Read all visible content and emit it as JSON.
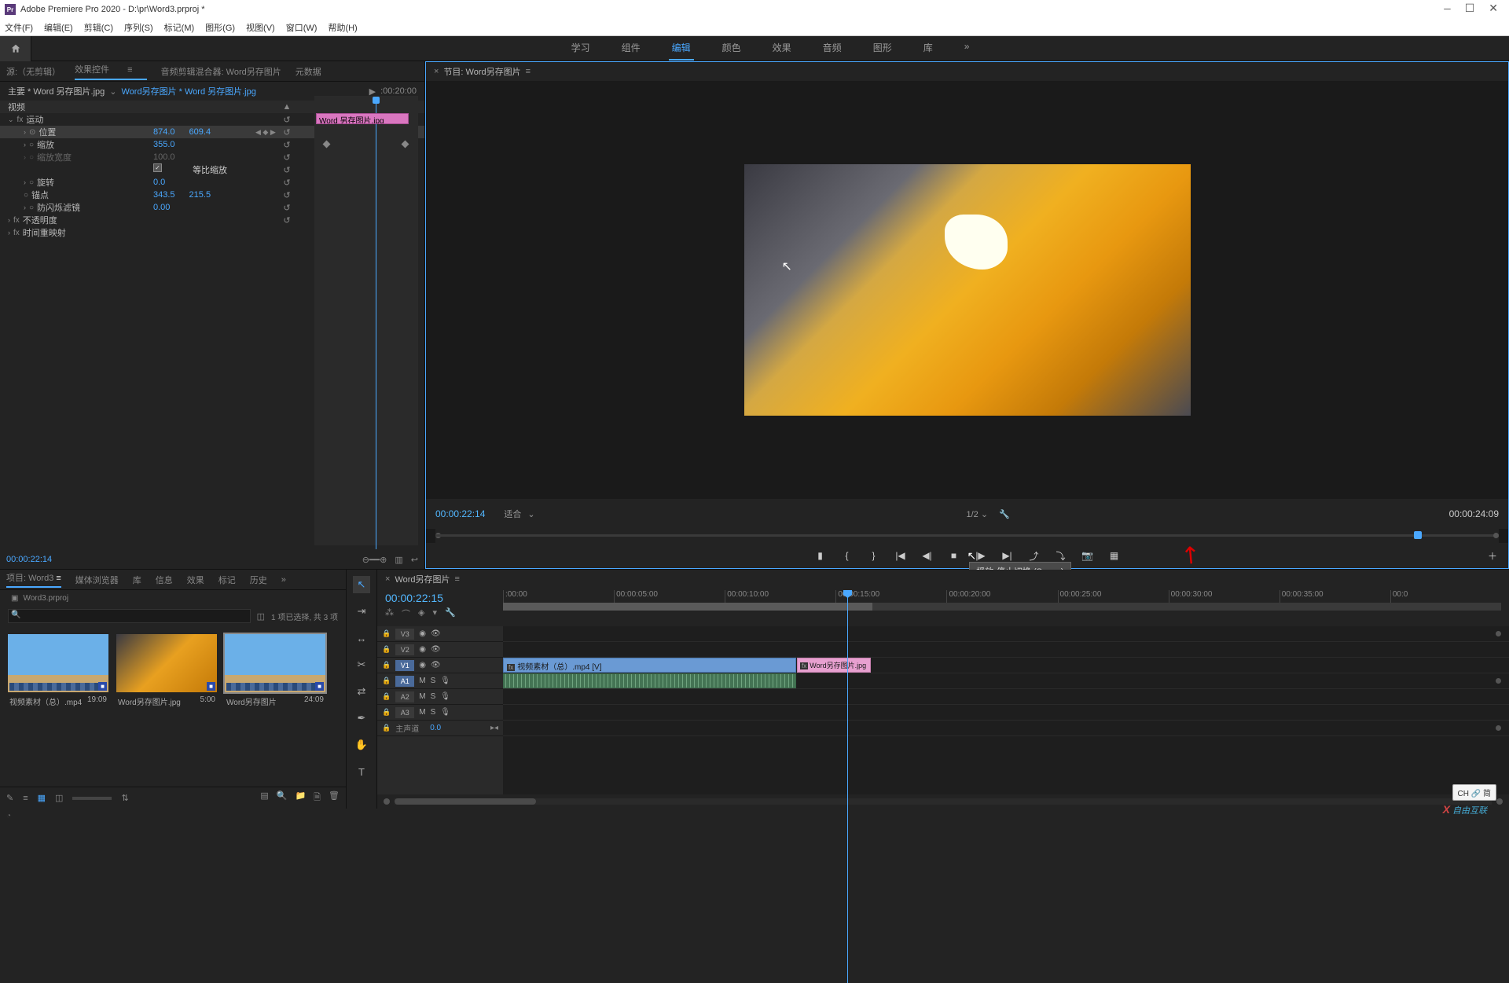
{
  "title_bar": {
    "app_name": "Adobe Premiere Pro 2020",
    "doc_path": "D:\\pr\\Word3.prproj *"
  },
  "menu": {
    "file": "文件(F)",
    "edit": "编辑(E)",
    "clip": "剪辑(C)",
    "sequence": "序列(S)",
    "marker": "标记(M)",
    "graphics": "图形(G)",
    "view": "视图(V)",
    "window": "窗口(W)",
    "help": "帮助(H)"
  },
  "workspaces": {
    "learning": "学习",
    "assembly": "组件",
    "editing": "编辑",
    "color": "颜色",
    "effects": "效果",
    "audio": "音频",
    "graphics": "图形",
    "libraries": "库",
    "more": "»"
  },
  "source_tabs": {
    "source": "源:（无剪辑）",
    "effect_controls": "效果控件",
    "audio_mixer": "音频剪辑混合器: Word另存图片",
    "metadata": "元数据"
  },
  "effect_controls": {
    "master": "主要 * Word 另存图片.jpg",
    "link_a": "Word另存图片",
    "link_b": "* Word 另存图片.jpg",
    "header_tc": ":00:20:00",
    "mini_clip": "Word 另存图片.jpg",
    "section_video": "视频",
    "fx_motion": "运动",
    "prop_position": "位置",
    "pos_x": "874.0",
    "pos_y": "609.4",
    "prop_scale": "缩放",
    "scale_val": "355.0",
    "prop_scale_w": "缩放宽度",
    "scale_w_val": "100.0",
    "uniform": "等比缩放",
    "prop_rotation": "旋转",
    "rot_val": "0.0",
    "prop_anchor": "锚点",
    "anchor_x": "343.5",
    "anchor_y": "215.5",
    "prop_antiflicker": "防闪烁滤镜",
    "antiflicker_val": "0.00",
    "fx_opacity": "不透明度",
    "fx_timeremap": "时间重映射",
    "footer_tc": "00:00:22:14"
  },
  "program": {
    "tab_label": "节目: Word另存图片",
    "tc_left": "00:00:22:14",
    "fit": "适合",
    "resolution": "1/2",
    "tc_right": "00:00:24:09",
    "tooltip": "播放-停止切换 (Space)"
  },
  "project_tabs": {
    "project": "项目: Word3",
    "media_browser": "媒体浏览器",
    "libraries": "库",
    "info": "信息",
    "effects": "效果",
    "markers": "标记",
    "history": "历史",
    "more": "»"
  },
  "project": {
    "bin": "Word3.prproj",
    "search_placeholder": "",
    "status": "1 项已选择, 共 3 项",
    "items": [
      {
        "name": "视频素材（总）.mp4",
        "dur": "19:09"
      },
      {
        "name": "Word另存图片.jpg",
        "dur": "5:00"
      },
      {
        "name": "Word另存图片",
        "dur": "24:09"
      }
    ]
  },
  "timeline": {
    "tab_label": "Word另存图片",
    "tc": "00:00:22:15",
    "ruler": [
      ":00:00",
      "00:00:05:00",
      "00:00:10:00",
      "00:00:15:00",
      "00:00:20:00",
      "00:00:25:00",
      "00:00:30:00",
      "00:00:35:00",
      "00:0"
    ],
    "tracks": {
      "v3": "V3",
      "v2": "V2",
      "v1": "V1",
      "a1": "A1",
      "a2": "A2",
      "a3": "A3",
      "master": "主声道",
      "master_val": "0.0",
      "m": "M",
      "s": "S"
    },
    "clip_video": "视频素材（总）.mp4 [V]",
    "clip_image": "Word另存图片.jpg"
  },
  "ime": "CH 🔗 简",
  "watermark": "自由互联"
}
